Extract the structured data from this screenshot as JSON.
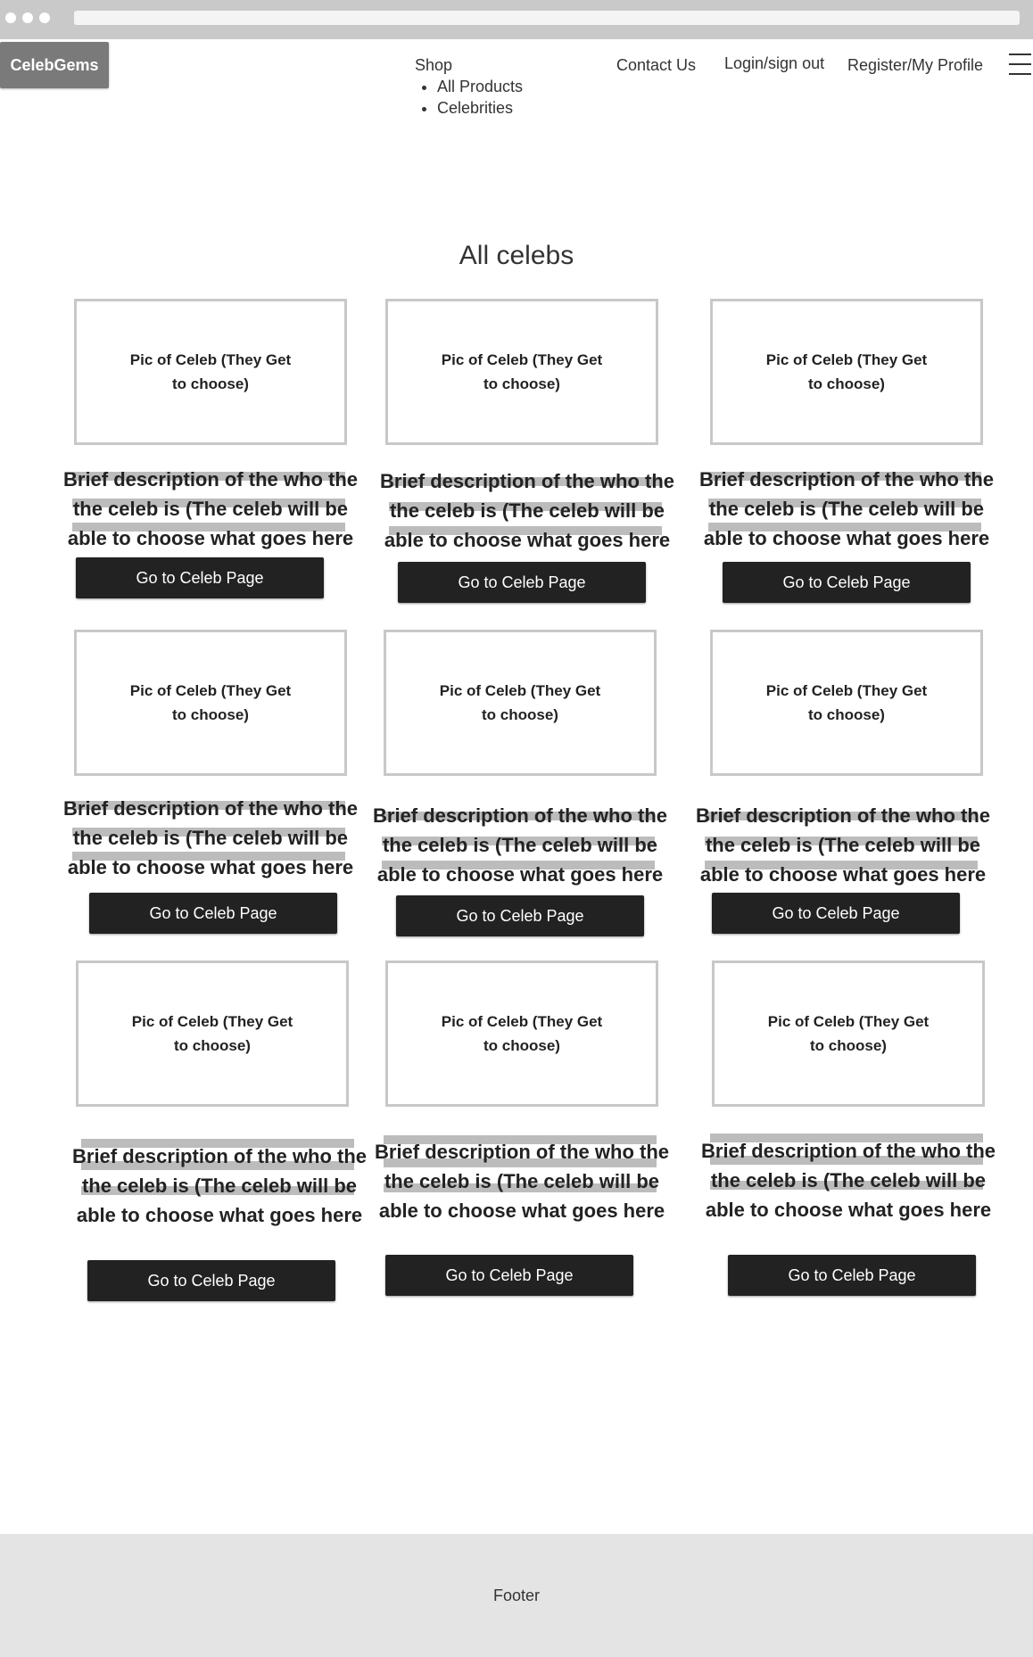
{
  "header": {
    "logo": "CelebGems",
    "nav": {
      "shop": "Shop",
      "shop_items": [
        "All Products",
        "Celebrities"
      ],
      "contact": "Contact Us",
      "login": "Login/sign out",
      "register": "Register/My Profile"
    },
    "menu_icon": "hamburger-menu-icon"
  },
  "main": {
    "title": "All celebs",
    "cards": [
      {
        "pic": "Pic of Celeb (They Get to choose)",
        "description": "Brief description of the who the the celeb is (The celeb will be able to choose what goes here",
        "button": "Go to Celeb Page"
      },
      {
        "pic": "Pic of Celeb (They Get to choose)",
        "description": "Brief description of the who the the celeb is (The celeb will be able to choose what goes here",
        "button": "Go to Celeb Page"
      },
      {
        "pic": "Pic of Celeb (They Get to choose)",
        "description": "Brief description of the who the the celeb is (The celeb will be able to choose what goes here",
        "button": "Go to Celeb Page"
      },
      {
        "pic": "Pic of Celeb (They Get to choose)",
        "description": "Brief description of the who the the celeb is (The celeb will be able to choose what goes here",
        "button": "Go to Celeb Page"
      },
      {
        "pic": "Pic of Celeb (They Get to choose)",
        "description": "Brief description of the who the the celeb is (The celeb will be able to choose what goes here",
        "button": "Go to Celeb Page"
      },
      {
        "pic": "Pic of Celeb (They Get to choose)",
        "description": "Brief description of the who the the celeb is (The celeb will be able to choose what goes here",
        "button": "Go to Celeb Page"
      },
      {
        "pic": "Pic of Celeb (They Get to choose)",
        "description": "Brief description of the who the the celeb is (The celeb will be able to choose what goes here",
        "button": "Go to Celeb Page"
      },
      {
        "pic": "Pic of Celeb (They Get to choose)",
        "description": "Brief description of the who the the celeb is (The celeb will be able to choose what goes here",
        "button": "Go to Celeb Page"
      },
      {
        "pic": "Pic of Celeb (They Get to choose)",
        "description": "Brief description of the who the the celeb is (The celeb will be able to choose what goes here",
        "button": "Go to Celeb Page"
      }
    ]
  },
  "footer": {
    "text": "Footer"
  },
  "colors": {
    "button_bg": "#222222",
    "logo_bg": "#7a7a7a",
    "footer_bg": "#e4e4e4",
    "highlight": "#bcbcbc"
  }
}
